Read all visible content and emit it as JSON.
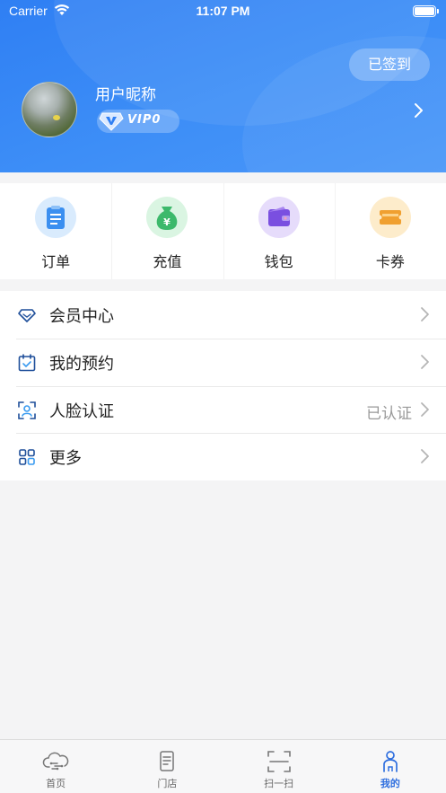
{
  "status_bar": {
    "carrier": "Carrier",
    "time": "11:07 PM"
  },
  "header": {
    "checkin_label": "已签到",
    "nickname": "用户昵称",
    "vip_label": "VIP0"
  },
  "quick_actions": [
    {
      "label": "订单",
      "icon": "order-icon",
      "color": "#3b8ff0"
    },
    {
      "label": "充值",
      "icon": "recharge-money-bag-icon",
      "color": "#3cb96b"
    },
    {
      "label": "钱包",
      "icon": "wallet-icon",
      "color": "#7a4fe0"
    },
    {
      "label": "卡券",
      "icon": "coupon-icon",
      "color": "#f0a030"
    }
  ],
  "menu": [
    {
      "label": "会员中心",
      "icon": "diamond-icon",
      "value": ""
    },
    {
      "label": "我的预约",
      "icon": "calendar-check-icon",
      "value": ""
    },
    {
      "label": "人脸认证",
      "icon": "face-scan-icon",
      "value": "已认证"
    },
    {
      "label": "更多",
      "icon": "grid-icon",
      "value": ""
    }
  ],
  "tabbar": {
    "active_index": 3,
    "active_color": "#2f6fdf",
    "items": [
      {
        "label": "首页",
        "icon": "cloud-home-icon"
      },
      {
        "label": "门店",
        "icon": "store-document-icon"
      },
      {
        "label": "扫一扫",
        "icon": "scan-icon"
      },
      {
        "label": "我的",
        "icon": "user-icon"
      }
    ]
  }
}
